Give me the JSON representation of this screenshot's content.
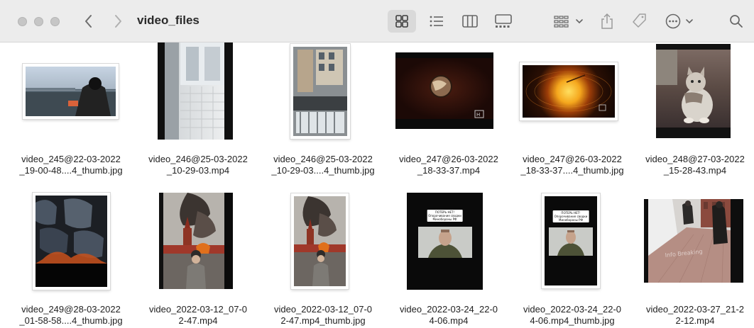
{
  "window": {
    "title": "video_files"
  },
  "toolbar": {
    "back_icon": "chevron-left-icon",
    "forward_icon": "chevron-right-icon",
    "view_modes": [
      "icons-view",
      "list-view",
      "columns-view",
      "gallery-view"
    ],
    "selected_view": "icons-view",
    "group_icon": "group-by-icon",
    "share_icon": "share-icon",
    "tag_icon": "tag-icon",
    "more_icon": "ellipsis-circle-icon",
    "search_icon": "search-icon"
  },
  "files": [
    {
      "line1": "video_245@22-03-2022",
      "line2": "_19-00-48....4_thumb.jpg",
      "scene": "man in black beanie at river railing"
    },
    {
      "line1": "video_246@25-03-2022",
      "line2": "_10-29-03.mp4",
      "scene": "window with tiled wall"
    },
    {
      "line1": "video_246@25-03-2022",
      "line2": "_10-29-03....4_thumb.jpg",
      "scene": "building courtyard from above"
    },
    {
      "line1": "video_247@26-03-2022",
      "line2": "_18-33-37.mp4",
      "scene": "planet on dark background"
    },
    {
      "line1": "video_247@26-03-2022",
      "line2": "_18-33-37....4_thumb.jpg",
      "scene": "glowing sun"
    },
    {
      "line1": "video_248@27-03-2022",
      "line2": "_15-28-43.mp4",
      "scene": "cat sitting"
    },
    {
      "line1": "video_249@28-03-2022",
      "line2": "_01-58-58....4_thumb.jpg",
      "scene": "machinery with fire"
    },
    {
      "line1": "video_2022-03-12_07-0",
      "line2": "2-47.mp4",
      "scene": "reporter at red square with smoke"
    },
    {
      "line1": "video_2022-03-12_07-0",
      "line2": "2-47.mp4_thumb.jpg",
      "scene": "reporter at red square with smoke"
    },
    {
      "line1": "video_2022-03-24_22-0",
      "line2": "4-06.mp4",
      "scene": "soldier portrait with caption"
    },
    {
      "line1": "video_2022-03-24_22-0",
      "line2": "4-06.mp4_thumb.jpg",
      "scene": "soldier portrait with caption"
    },
    {
      "line1": "video_2022-03-27_21-2",
      "line2": "2-12.mp4",
      "scene": "snowy street with pedestrians"
    }
  ],
  "overlays": {
    "caption_lines": [
      "ПОТЕРЬ НЕТ!",
      "Опорочивание сводки",
      "Минобороны РФ"
    ],
    "watermark": "Info Breaking"
  },
  "colors": {
    "toolbar_bg": "#ececec",
    "window_bg": "#ffffff",
    "selected_view_bg": "#d9d9d9"
  }
}
